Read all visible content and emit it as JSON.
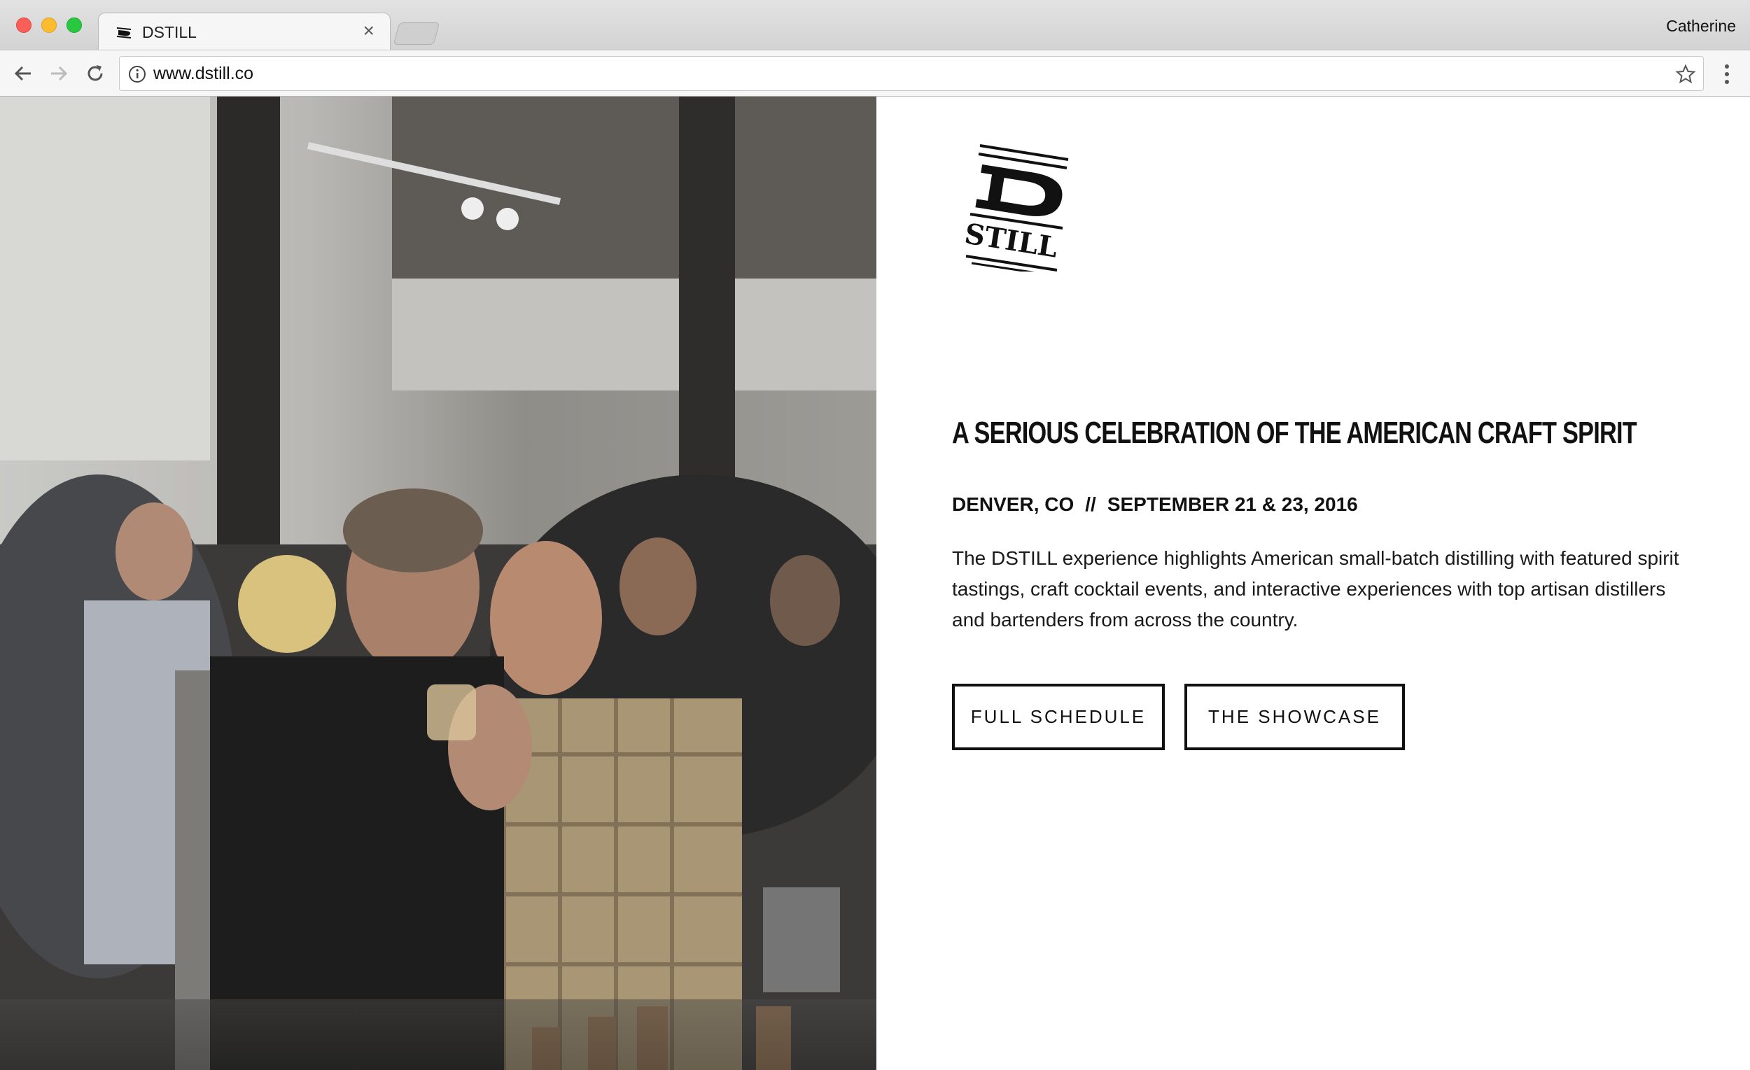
{
  "browser": {
    "tab": {
      "title": "DSTILL",
      "favicon": "dstill-logo-icon"
    },
    "profile_name": "Catherine",
    "address_bar": {
      "url": "www.dstill.co"
    }
  },
  "page": {
    "brand": {
      "logo_letter": "D",
      "logo_word": "STILL"
    },
    "headline": "A SERIOUS CELEBRATION OF THE AMERICAN CRAFT SPIRIT",
    "location": "DENVER, CO",
    "separator": "//",
    "dates": "SEPTEMBER 21 & 23, 2016",
    "description": "The DSTILL experience highlights American small-batch distilling with featured spirit tastings, craft cocktail events, and interactive experiences with top artisan distillers and bartenders from across the country.",
    "buttons": {
      "schedule": "FULL SCHEDULE",
      "showcase": "THE SHOWCASE"
    }
  },
  "colors": {
    "text": "#111111",
    "background": "#ffffff",
    "button_border": "#111111"
  }
}
